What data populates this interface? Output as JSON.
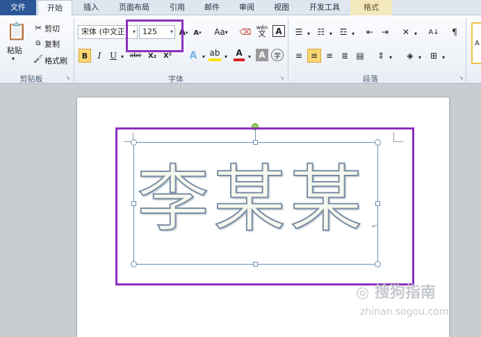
{
  "tabs": [
    "文件",
    "开始",
    "插入",
    "页面布局",
    "引用",
    "邮件",
    "审阅",
    "视图",
    "开发工具",
    "格式"
  ],
  "clipboard": {
    "paste": "粘贴",
    "cut": "剪切",
    "copy": "复制",
    "format_painter": "格式刷",
    "group": "剪贴板"
  },
  "font": {
    "name": "宋体 (中文正文)",
    "name_shown": "宋体 (中文正",
    "size": "125",
    "change_case": "Aa",
    "bold": "B",
    "italic": "I",
    "underline": "U",
    "strike": "abe",
    "subscript": "X₂",
    "superscript": "X²",
    "char_border": "A",
    "char_shade": "A",
    "phonetic": "wén",
    "group": "字体"
  },
  "paragraph": {
    "group": "段落"
  },
  "document": {
    "wordart_text": "李某某"
  },
  "watermark": {
    "main": "搜狗指南",
    "sub": "zhinan.sogou.com"
  },
  "colors": {
    "highlight": "#8a2fbd",
    "file_tab": "#2b5797",
    "wordart_outline": "#7a8ea3",
    "font_red": "#d82020",
    "highlight_yellow": "#ffe400"
  }
}
